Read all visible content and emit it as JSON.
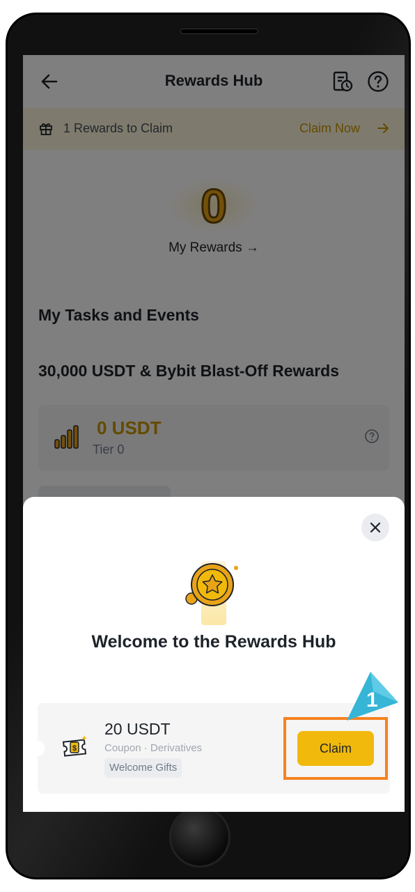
{
  "header": {
    "title": "Rewards Hub",
    "back_icon": "arrow-left-icon",
    "history_icon": "history-icon",
    "help_icon": "question-circle-icon"
  },
  "claim_banner": {
    "text": "1 Rewards to Claim",
    "action": "Claim Now",
    "icon": "gift-icon"
  },
  "rewards": {
    "amount": "0",
    "link_label": "My Rewards →"
  },
  "tasks": {
    "heading": "My Tasks and Events",
    "event_title": "30,000 USDT & Bybit Blast-Off Rewards",
    "event_amount": "0 USDT",
    "event_tier": "Tier 0"
  },
  "modal": {
    "title": "Welcome to the Rewards Hub",
    "coupon": {
      "amount": "20 USDT",
      "type": "Coupon · Derivatives",
      "tag": "Welcome Gifts",
      "claim_label": "Claim"
    }
  },
  "callout": {
    "step_number": "1"
  },
  "colors": {
    "accent": "#f0b90b",
    "accent_text": "#c99400",
    "highlight": "#f58220",
    "callout": "#36b5d6",
    "overlay": "rgba(0,0,0,0.5)"
  }
}
